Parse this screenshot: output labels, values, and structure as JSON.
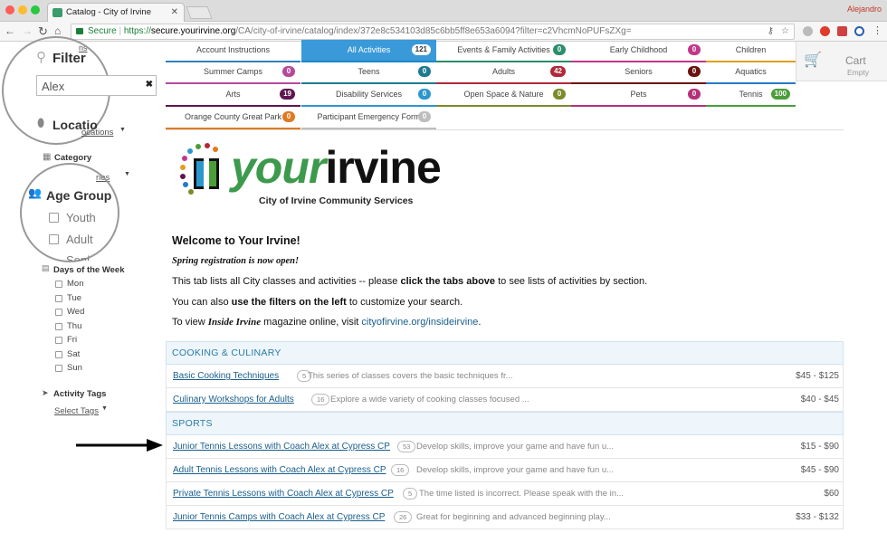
{
  "browser": {
    "tab_title": "Catalog - City of Irvine",
    "user": "Alejandro",
    "url_secure": "Secure",
    "url_scheme": "https://",
    "url_host": "secure.yourirvine.org",
    "url_path": "/CA/city-of-irvine/catalog/index/372e8c534103d85c6bb5ff8e653a6094?filter=c2VhcmNoPUFsZXg="
  },
  "sidebar": {
    "filter_title": "Filter",
    "search_value": "Alex",
    "location_title": "Locatio",
    "location_link": "ocations",
    "category_title": "Category",
    "category_link": "ries",
    "age_title": "Age Group",
    "age_options": [
      "Youth",
      "Adult",
      "Seni"
    ],
    "days_title": "Days of the Week",
    "days": [
      "Mon",
      "Tue",
      "Wed",
      "Thu",
      "Fri",
      "Sat",
      "Sun"
    ],
    "tags_title": "Activity Tags",
    "tags_link": "Select Tags",
    "top_cut_link": "ns"
  },
  "tabs": [
    {
      "label": "Account Instructions",
      "count": null,
      "color": "#2f7fbf"
    },
    {
      "label": "All Activities",
      "count": "121",
      "color": "#1e86c7",
      "active": true
    },
    {
      "label": "Events & Family Activities",
      "count": "0",
      "color": "#2a8f6a"
    },
    {
      "label": "Early Childhood",
      "count": "0",
      "color": "#c2378a"
    },
    {
      "label": "Children",
      "count": null,
      "color": "#e0a020"
    },
    {
      "label": "Summer Camps",
      "count": "0",
      "color": "#b54a9c"
    },
    {
      "label": "Teens",
      "count": "0",
      "color": "#1e7a8f"
    },
    {
      "label": "Adults",
      "count": "42",
      "color": "#b0283a"
    },
    {
      "label": "Seniors",
      "count": "0",
      "color": "#6b1010"
    },
    {
      "label": "Aquatics",
      "count": null,
      "color": "#2878c8"
    },
    {
      "label": "Arts",
      "count": "19",
      "color": "#5e1650"
    },
    {
      "label": "Disability Services",
      "count": "0",
      "color": "#2c97cf"
    },
    {
      "label": "Open Space & Nature",
      "count": "0",
      "color": "#7c8a2a"
    },
    {
      "label": "Pets",
      "count": "0",
      "color": "#b53078"
    },
    {
      "label": "Tennis",
      "count": "100",
      "color": "#4a9e3a"
    },
    {
      "label": "Orange County Great Park",
      "count": "0",
      "color": "#e07a20"
    },
    {
      "label": "Participant Emergency Form",
      "count": "0",
      "color": "#bdbdbd"
    }
  ],
  "cart": {
    "label": "Cart",
    "status": "Empty"
  },
  "logo": {
    "word1": "your",
    "word2": "irvine",
    "subtitle": "City of Irvine Community Services"
  },
  "welcome": {
    "heading": "Welcome to Your Irvine!",
    "spring": "Spring registration is now open!",
    "p1_a": "This tab lists all City classes and activities -- please ",
    "p1_b": "click the tabs above",
    "p1_c": " to see lists of activities by section.",
    "p2_a": "You can also ",
    "p2_b": "use the filters on the left",
    "p2_c": " to customize your search.",
    "p3_a": "To view ",
    "p3_b": "Inside Irvine",
    "p3_c": " magazine online, visit ",
    "p3_link": "cityofirvine.org/insideirvine",
    "p3_d": "."
  },
  "sections": [
    {
      "title": "COOKING & CULINARY",
      "rows": [
        {
          "name": "Basic Cooking Techniques",
          "count": "5",
          "desc": "This series of classes covers the basic techniques fr...",
          "price": "$45 - $125"
        },
        {
          "name": "Culinary Workshops for Adults",
          "count": "16",
          "desc": "Explore a wide variety of cooking classes focused ...",
          "price": "$40 - $45"
        }
      ]
    },
    {
      "title": "SPORTS",
      "rows": [
        {
          "name": "Junior Tennis Lessons with Coach Alex at Cypress CP",
          "count": "53",
          "desc": "Develop skills, improve your game and have fun u...",
          "price": "$15 - $90"
        },
        {
          "name": "Adult Tennis Lessons with Coach Alex at Cypress CP",
          "count": "16",
          "desc": "Develop skills, improve your game and have fun u...",
          "price": "$45 - $90"
        },
        {
          "name": "Private Tennis Lessons with Coach Alex at Cypress CP",
          "count": "5",
          "desc": "The time listed is incorrect. Please speak with the in...",
          "price": "$60"
        },
        {
          "name": "Junior Tennis Camps with Coach Alex at Cypress CP",
          "count": "26",
          "desc": "Great for beginning and advanced beginning play...",
          "price": "$33 - $132"
        }
      ]
    }
  ]
}
